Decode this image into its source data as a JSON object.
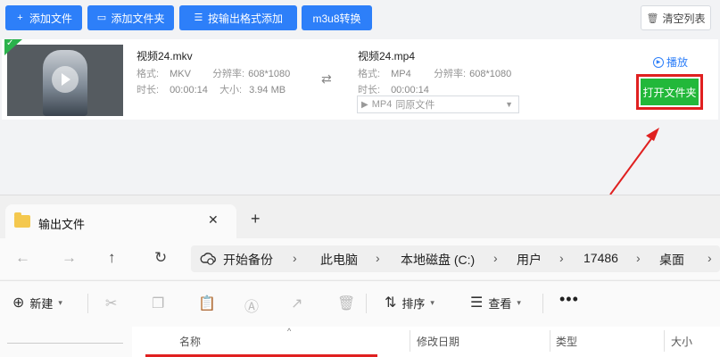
{
  "toolbar": {
    "add_file": "添加文件",
    "add_folder": "添加文件夹",
    "add_by_format": "按输出格式添加",
    "m3u8": "m3u8转换",
    "clear_list": "清空列表"
  },
  "file_item": {
    "source": {
      "name": "视频24.mkv",
      "format_label": "格式:",
      "format": "MKV",
      "resolution_label": "分辨率:",
      "resolution": "608*1080",
      "duration_label": "时长:",
      "duration": "00:00:14",
      "size_label": "大小:",
      "size": "3.94 MB"
    },
    "output": {
      "name": "视频24.mp4",
      "format_label": "格式:",
      "format": "MP4",
      "resolution_label": "分辨率:",
      "resolution": "608*1080",
      "duration_label": "时长:",
      "duration": "00:00:14",
      "select_format": "MP4",
      "select_quality": "同原文件"
    },
    "play_label": "播放",
    "open_folder_label": "打开文件夹"
  },
  "explorer": {
    "tab_title": "输出文件",
    "close_glyph": "✕",
    "new_tab_glyph": "+",
    "breadcrumbs": [
      "开始备份",
      "此电脑",
      "本地磁盘 (C:)",
      "用户",
      "17486",
      "桌面"
    ],
    "commands": {
      "new": "新建",
      "sort": "排序",
      "view": "查看",
      "more": "•••"
    },
    "columns": {
      "name": "名称",
      "modified": "修改日期",
      "type": "类型",
      "size": "大小"
    }
  },
  "colors": {
    "primary_blue": "#2d7ff9",
    "open_green": "#22b83a",
    "highlight_red": "#e02020"
  }
}
